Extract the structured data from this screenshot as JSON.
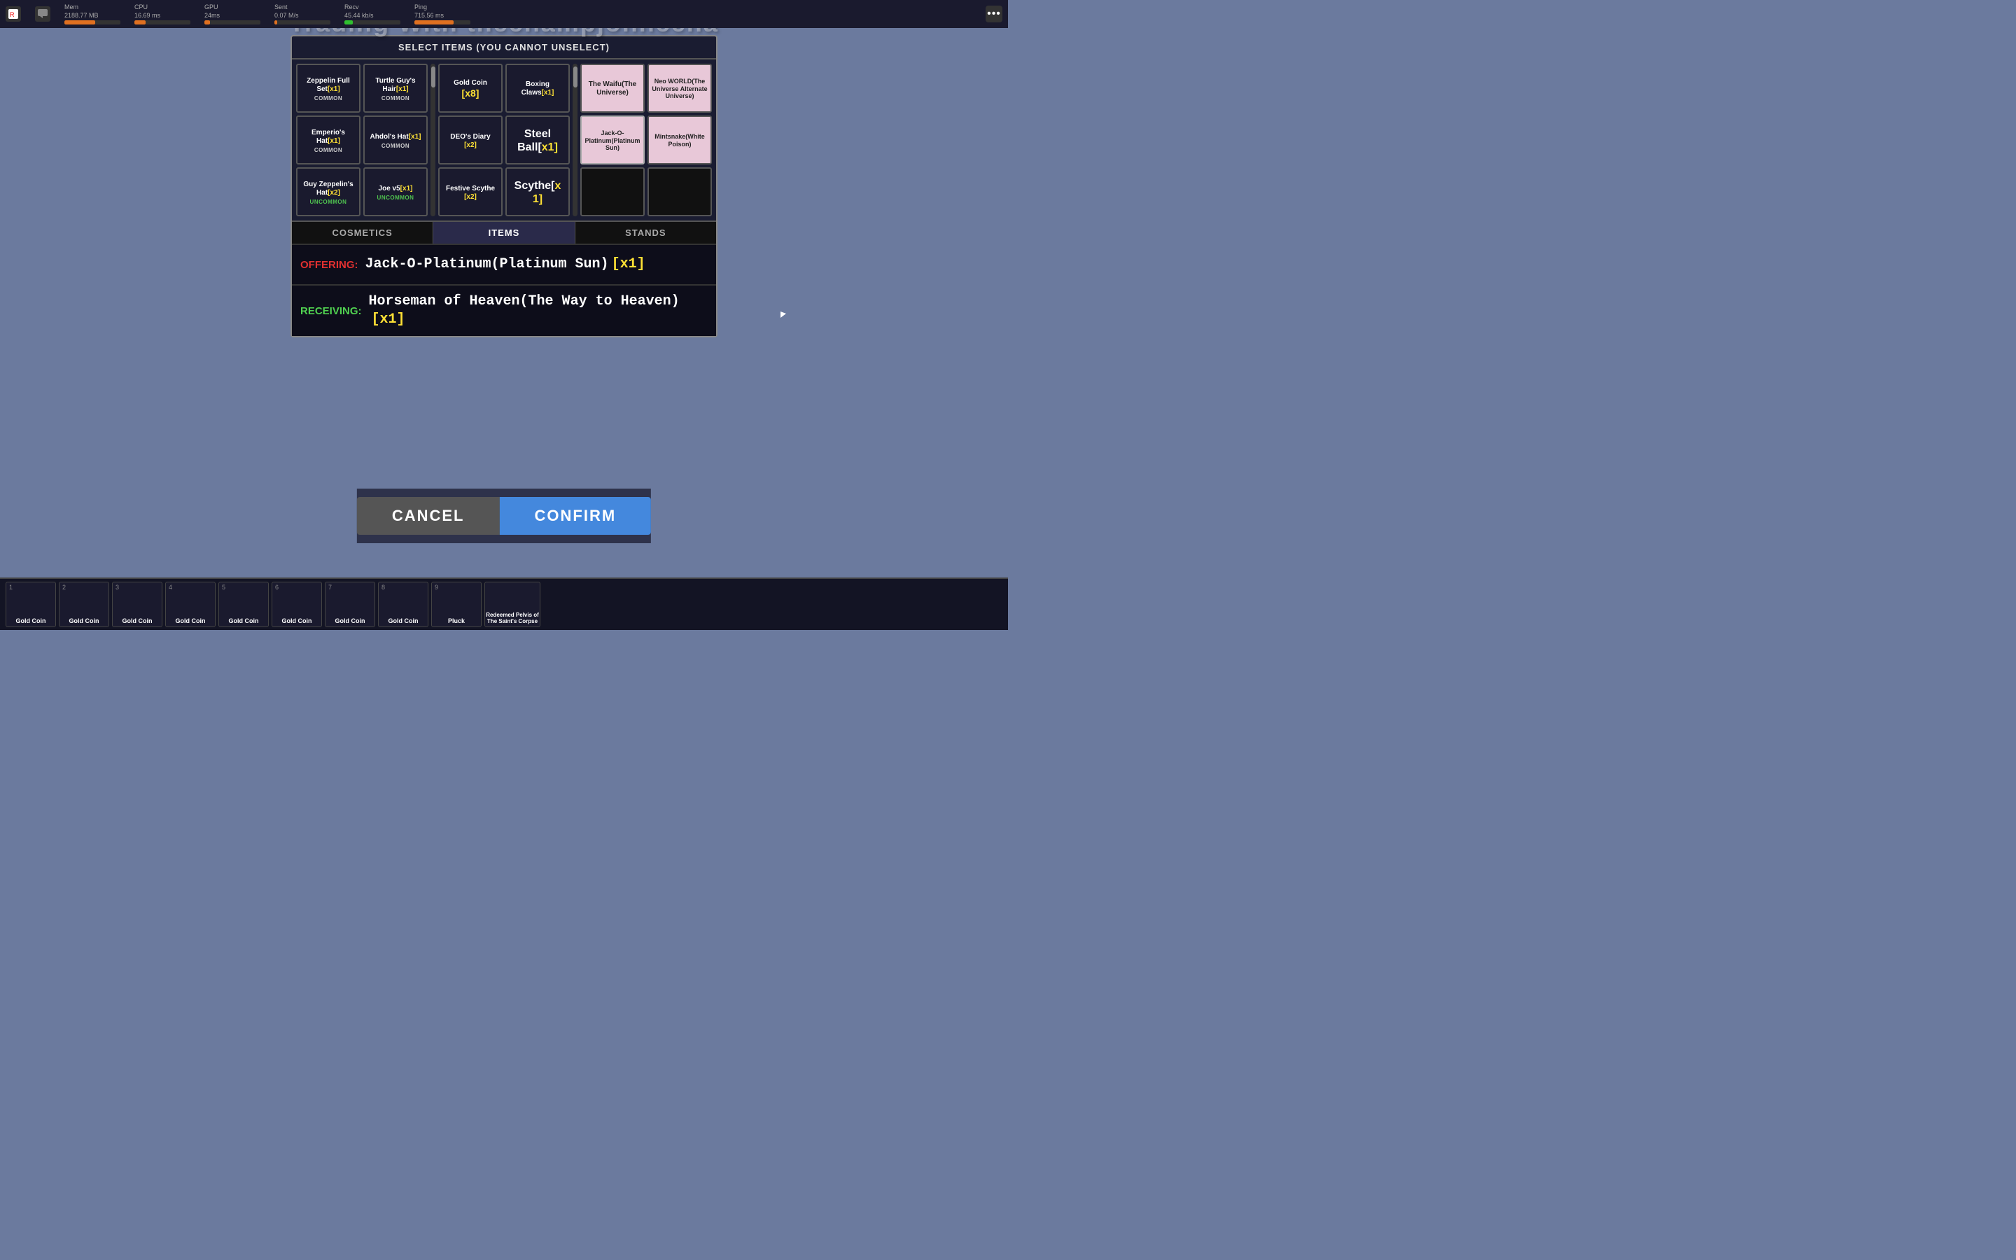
{
  "topbar": {
    "mem_label": "Mem",
    "mem_value": "2188.77 MB",
    "cpu_label": "CPU",
    "cpu_value": "16.69 ms",
    "gpu_label": "GPU",
    "gpu_value": "24ms",
    "sent_label": "Sent",
    "sent_value": "0.07 M/s",
    "recv_label": "Recv",
    "recv_value": "45.44 kb/s",
    "ping_label": "Ping",
    "ping_value": "715.56 ms",
    "mem_pct": 55,
    "cpu_pct": 20,
    "gpu_pct": 10,
    "sent_pct": 5,
    "recv_pct": 15,
    "ping_pct": 70
  },
  "main_title": "Trading With thechampjohncena",
  "select_header": "SELECT ITEMS (YOU CANNOT UNSELECT)",
  "tabs": [
    "COSMETICS",
    "ITEMS",
    "STANDS"
  ],
  "active_tab": "ITEMS",
  "grid_rows": [
    [
      {
        "name": "Zeppelin Full Set",
        "qty": "[x1]",
        "rarity": "COMMON",
        "light": false
      },
      {
        "name": "Turtle Guy's Hair",
        "qty": "[x1]",
        "rarity": "COMMON",
        "light": false
      },
      {
        "name": "Gold Coin",
        "qty": "[x8]",
        "rarity": "",
        "light": false,
        "qty_color": "yellow"
      },
      {
        "name": "Boxing Claws",
        "qty": "[x1]",
        "rarity": "",
        "light": false
      },
      {
        "name": "The Waifu(The Universe)",
        "qty": "",
        "rarity": "",
        "light": true
      },
      {
        "name": "Neo WORLD(The Universe Alternate Universe)",
        "qty": "",
        "rarity": "",
        "light": true
      }
    ],
    [
      {
        "name": "Emperio's Hat",
        "qty": "[x1]",
        "rarity": "COMMON",
        "light": false
      },
      {
        "name": "Ahdol's Hat",
        "qty": "[x1]",
        "rarity": "COMMON",
        "light": false
      },
      {
        "name": "DEO's Diary",
        "qty": "[x2]",
        "rarity": "",
        "light": false,
        "qty_color": "yellow"
      },
      {
        "name": "Steel Ball[",
        "qty": "x1]",
        "rarity": "",
        "light": false,
        "large": true
      },
      {
        "name": "Jack-O-Platinum(Platinum Sun)",
        "qty": "",
        "rarity": "",
        "light": true
      },
      {
        "name": "Mintsnake(White Poison)",
        "qty": "",
        "rarity": "",
        "light": true
      }
    ],
    [
      {
        "name": "Guy Zeppelin's Hat",
        "qty": "[x2]",
        "rarity": "UNCOMMON",
        "light": false
      },
      {
        "name": "Joe v5",
        "qty": "[x1]",
        "rarity": "UNCOMMON",
        "light": false
      },
      {
        "name": "Festive Scythe",
        "qty": "[x2]",
        "rarity": "",
        "light": false,
        "qty_color": "yellow"
      },
      {
        "name": "Scythe[x",
        "qty": "1]",
        "rarity": "",
        "light": false,
        "large": true
      },
      null,
      null
    ]
  ],
  "offering": {
    "label": "OFFERING:",
    "text": "Jack-O-Platinum(Platinum Sun)",
    "qty": "[x1]"
  },
  "receiving": {
    "label": "RECEIVING:",
    "text": "Horseman of Heaven(The Way to Heaven)",
    "qty": "[x1]"
  },
  "buttons": {
    "cancel": "CANCEL",
    "confirm": "CONFIRM"
  },
  "inventory": [
    {
      "num": "1",
      "name": "Gold Coin"
    },
    {
      "num": "2",
      "name": "Gold Coin"
    },
    {
      "num": "3",
      "name": "Gold Coin"
    },
    {
      "num": "4",
      "name": "Gold Coin"
    },
    {
      "num": "5",
      "name": "Gold Coin"
    },
    {
      "num": "6",
      "name": "Gold Coin"
    },
    {
      "num": "7",
      "name": "Gold Coin"
    },
    {
      "num": "8",
      "name": "Gold Coin"
    },
    {
      "num": "9",
      "name": "Pluck"
    },
    {
      "num": "",
      "name": "Redeemed Pelvis of The Saint's Corpse"
    }
  ]
}
